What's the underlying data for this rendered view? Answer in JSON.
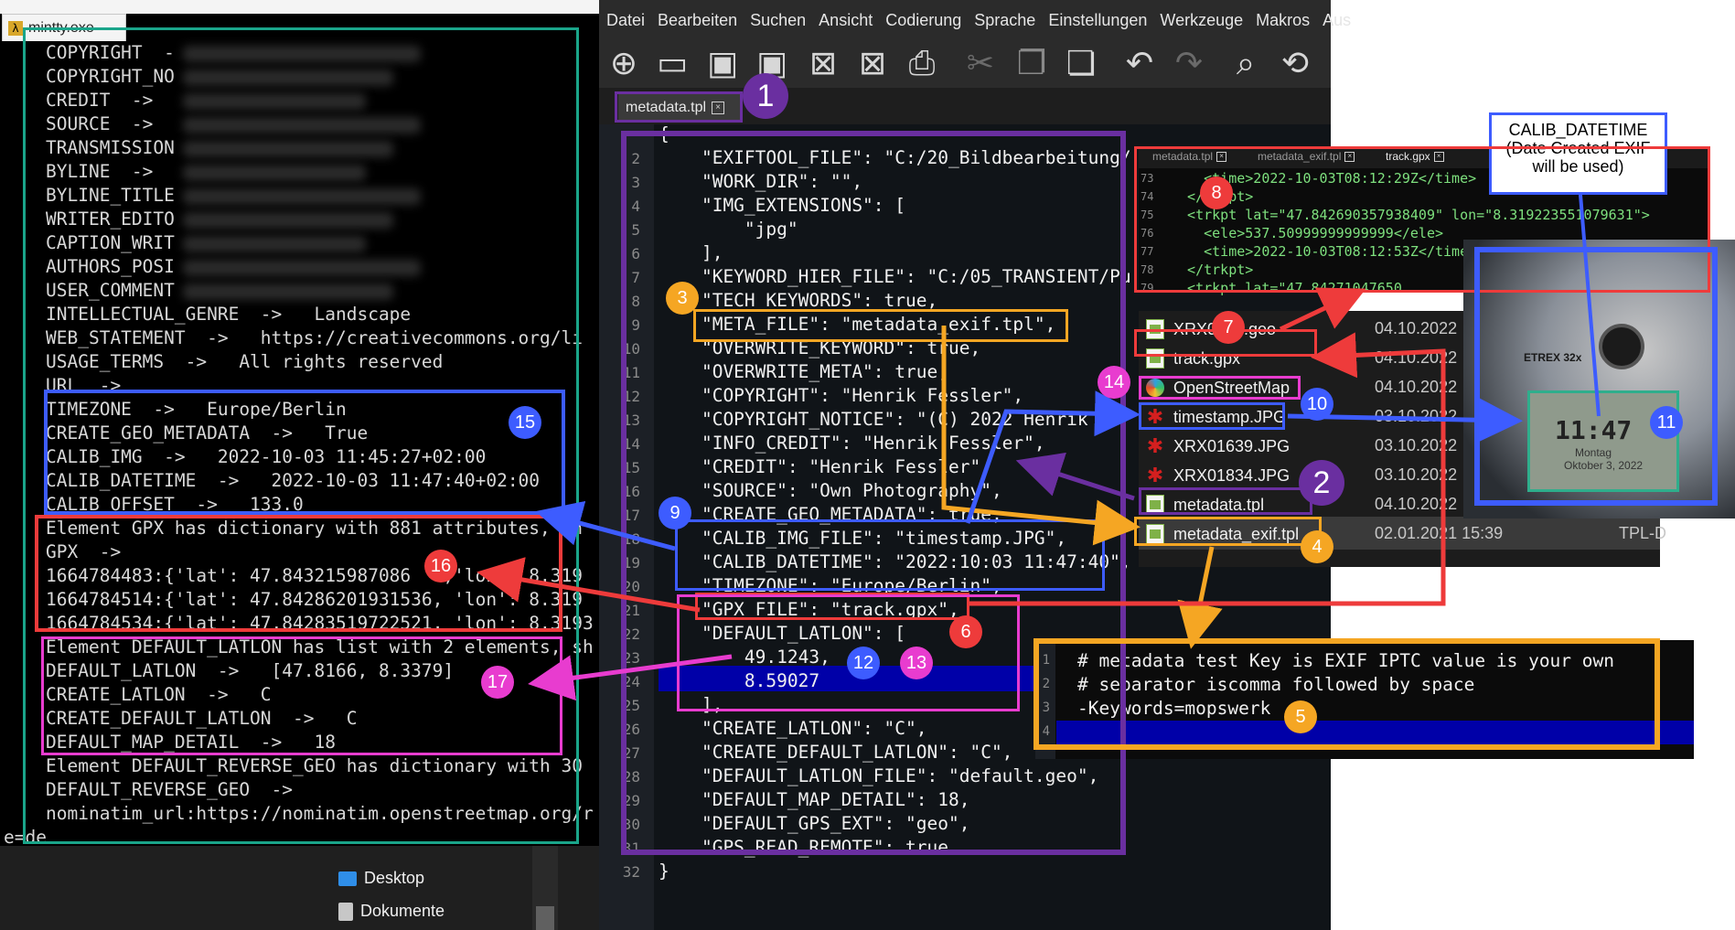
{
  "terminal": {
    "title": "mintty.exe",
    "icon_glyph": "λ",
    "lines": [
      "COPYRIGHT  -",
      "COPYRIGHT_NO",
      "CREDIT  ->",
      "SOURCE  ->",
      "TRANSMISSION",
      "BYLINE  ->",
      "BYLINE_TITLE",
      "WRITER_EDITO",
      "CAPTION_WRIT",
      "AUTHORS_POSI",
      "USER_COMMENT",
      "INTELLECTUAL_GENRE  ->   Landscape",
      "WEB_STATEMENT  ->   https://creativecommons.org/li",
      "USAGE_TERMS  ->   All rights reserved",
      "URL  ->",
      "TIMEZONE  ->   Europe/Berlin",
      "CREATE_GEO_METADATA  ->   True",
      "CALIB_IMG  ->   2022-10-03 11:45:27+02:00",
      "CALIB_DATETIME  ->   2022-10-03 11:47:40+02:00",
      "CALIB_OFFSET  ->   133.0",
      "Element GPX has dictionary with 881 attributes, sh",
      "GPX  ->",
      "1664784483:{'lat': 47.843215987086   ,'lon': 8.319",
      "1664784514:{'lat': 47.84286201931536, 'lon': 8.319",
      "1664784534:{'lat': 47.84283519722521, 'lon': 8.3193",
      "Element DEFAULT_LATLON has list with 2 elements, sh",
      "DEFAULT_LATLON  ->   [47.8166, 8.3379]",
      "CREATE_LATLON  ->   C",
      "CREATE_DEFAULT_LATLON  ->   C",
      "DEFAULT_MAP_DETAIL  ->   18",
      "Element DEFAULT_REVERSE_GEO has dictionary with 30",
      "DEFAULT_REVERSE_GEO  ->",
      "nominatim_url:https://nominatim.openstreetmap.org/r",
      "e=de"
    ]
  },
  "explorer": {
    "items": [
      {
        "label": "Desktop",
        "color": "#2f8ee8"
      },
      {
        "label": "Dokumente",
        "color": "#c7c7c7"
      }
    ]
  },
  "npp": {
    "menu": [
      "Datei",
      "Bearbeiten",
      "Suchen",
      "Ansicht",
      "Codierung",
      "Sprache",
      "Einstellungen",
      "Werkzeuge",
      "Makros",
      "Aus"
    ],
    "toolbar_icons": [
      "new-file-icon",
      "open-folder-icon",
      "save-icon",
      "save-all-icon",
      "close-icon",
      "close-all-icon",
      "print-icon",
      "cut-icon",
      "copy-icon",
      "paste-icon",
      "undo-icon",
      "redo-icon",
      "find-icon",
      "replace-icon"
    ],
    "active_tab": "metadata.tpl",
    "line_numbers": [
      "2",
      "3",
      "4",
      "5",
      "6",
      "7",
      "8",
      "9",
      "10",
      "11",
      "12",
      "13",
      "14",
      "15",
      "16",
      "17",
      "18",
      "19",
      "20",
      "21",
      "22",
      "23",
      "24",
      "25",
      "26",
      "27",
      "28",
      "29",
      "30",
      "31",
      "32"
    ],
    "code": [
      "{",
      "    \"EXIFTOOL_FILE\": \"C:/20_Bildbearbeitung/",
      "    \"WORK_DIR\": \"\",",
      "    \"IMG_EXTENSIONS\": [",
      "        \"jpg\"",
      "    ],",
      "    \"KEYWORD_HIER_FILE\": \"C:/05_TRANSIENT/Pu",
      "    \"TECH_KEYWORDS\": true,",
      "    \"META_FILE\": \"metadata_exif.tpl\",",
      "    \"OVERWRITE_KEYWORD\": true,",
      "    \"OVERWRITE_META\": true,",
      "    \"COPYRIGHT\": \"Henrik Fessler\",",
      "    \"COPYRIGHT_NOTICE\": \"(C) 2022 Henrik",
      "    \"INFO_CREDIT\": \"Henrik Fessler\",",
      "    \"CREDIT\": \"Henrik Fessler\",",
      "    \"SOURCE\": \"Own Photography\",",
      "    \"CREATE_GEO_METADATA\": true,",
      "    \"CALIB_IMG_FILE\": \"timestamp.JPG\",",
      "    \"CALIB_DATETIME\": \"2022:10:03 11:47:40\",",
      "    \"TIMEZONE\": \"Europe/Berlin\",",
      "    \"GPX_FILE\": \"track.gpx\",",
      "    \"DEFAULT_LATLON\": [",
      "        49.1243,",
      "        8.59027",
      "    ],",
      "    \"CREATE_LATLON\": \"C\",",
      "    \"CREATE_DEFAULT_LATLON\": \"C\",",
      "    \"DEFAULT_LATLON_FILE\": \"default.geo\",",
      "    \"DEFAULT_MAP_DETAIL\": 18,",
      "    \"DEFAULT_GPS_EXT\": \"geo\",",
      "    \"GPS_READ_REMOTE\": true",
      "}"
    ]
  },
  "gpx_view": {
    "tabs": [
      "metadata.tpl",
      "metadata_exif.tpl",
      "track.gpx"
    ],
    "line_numbers": [
      "73",
      "74",
      "75",
      "76",
      "77",
      "78",
      "79"
    ],
    "lines": [
      "    <time>2022-10-03T08:12:29Z</time>",
      "  </trkpt>",
      "  <trkpt lat=\"47.842690357938409\" lon=\"8.319223551079631\">",
      "    <ele>537.50999999999999</ele>",
      "    <time>2022-10-03T08:12:53Z</time>",
      "  </trkpt>",
      "  <trkpt lat=\"47.84271047650"
    ]
  },
  "files": [
    {
      "name": "XRX01... .geo",
      "date": "04.10.2022",
      "icon": "doc"
    },
    {
      "name": "track.gpx",
      "date": "04.10.2022",
      "icon": "doc"
    },
    {
      "name": "OpenStreetMap",
      "date": "04.10.2022",
      "icon": "edge"
    },
    {
      "name": "timestamp.JPG",
      "date": "03.10.2022",
      "icon": "star"
    },
    {
      "name": "XRX01639.JPG",
      "date": "03.10.2022",
      "icon": "star"
    },
    {
      "name": "XRX01834.JPG",
      "date": "03.10.2022",
      "icon": "star"
    },
    {
      "name": "metadata.tpl",
      "date": "04.10.2022",
      "icon": "doc"
    },
    {
      "name": "metadata_exif.tpl",
      "date": "02.01.2021 15:39",
      "icon": "doc",
      "type": "TPL-D"
    }
  ],
  "meta_exif": {
    "line_numbers": [
      "1",
      "2",
      "3",
      "4"
    ],
    "lines": [
      "# metadata test Key is EXIF IPTC value is your own",
      "# separator iscomma followed by space",
      "-Keywords=mopswerk",
      ""
    ]
  },
  "gps_device": {
    "brand": "ETREX 32x",
    "time": "11:47",
    "day": "Montag",
    "date": "Oktober 3, 2022"
  },
  "calib_note": {
    "line1": "CALIB_DATETIME",
    "line2": "(Date Created EXIF",
    "line3": "will be used)"
  },
  "annotations": {
    "badges": [
      "1",
      "2",
      "3",
      "4",
      "5",
      "6",
      "7",
      "8",
      "9",
      "10",
      "11",
      "12",
      "13",
      "14",
      "15",
      "16",
      "17"
    ],
    "colors": {
      "purple": "#6a2fa0",
      "orange": "#f5a623",
      "red": "#ee3b3b",
      "blue": "#3d5cff",
      "magenta": "#e83ccf",
      "teal": "#1aa58a"
    }
  }
}
